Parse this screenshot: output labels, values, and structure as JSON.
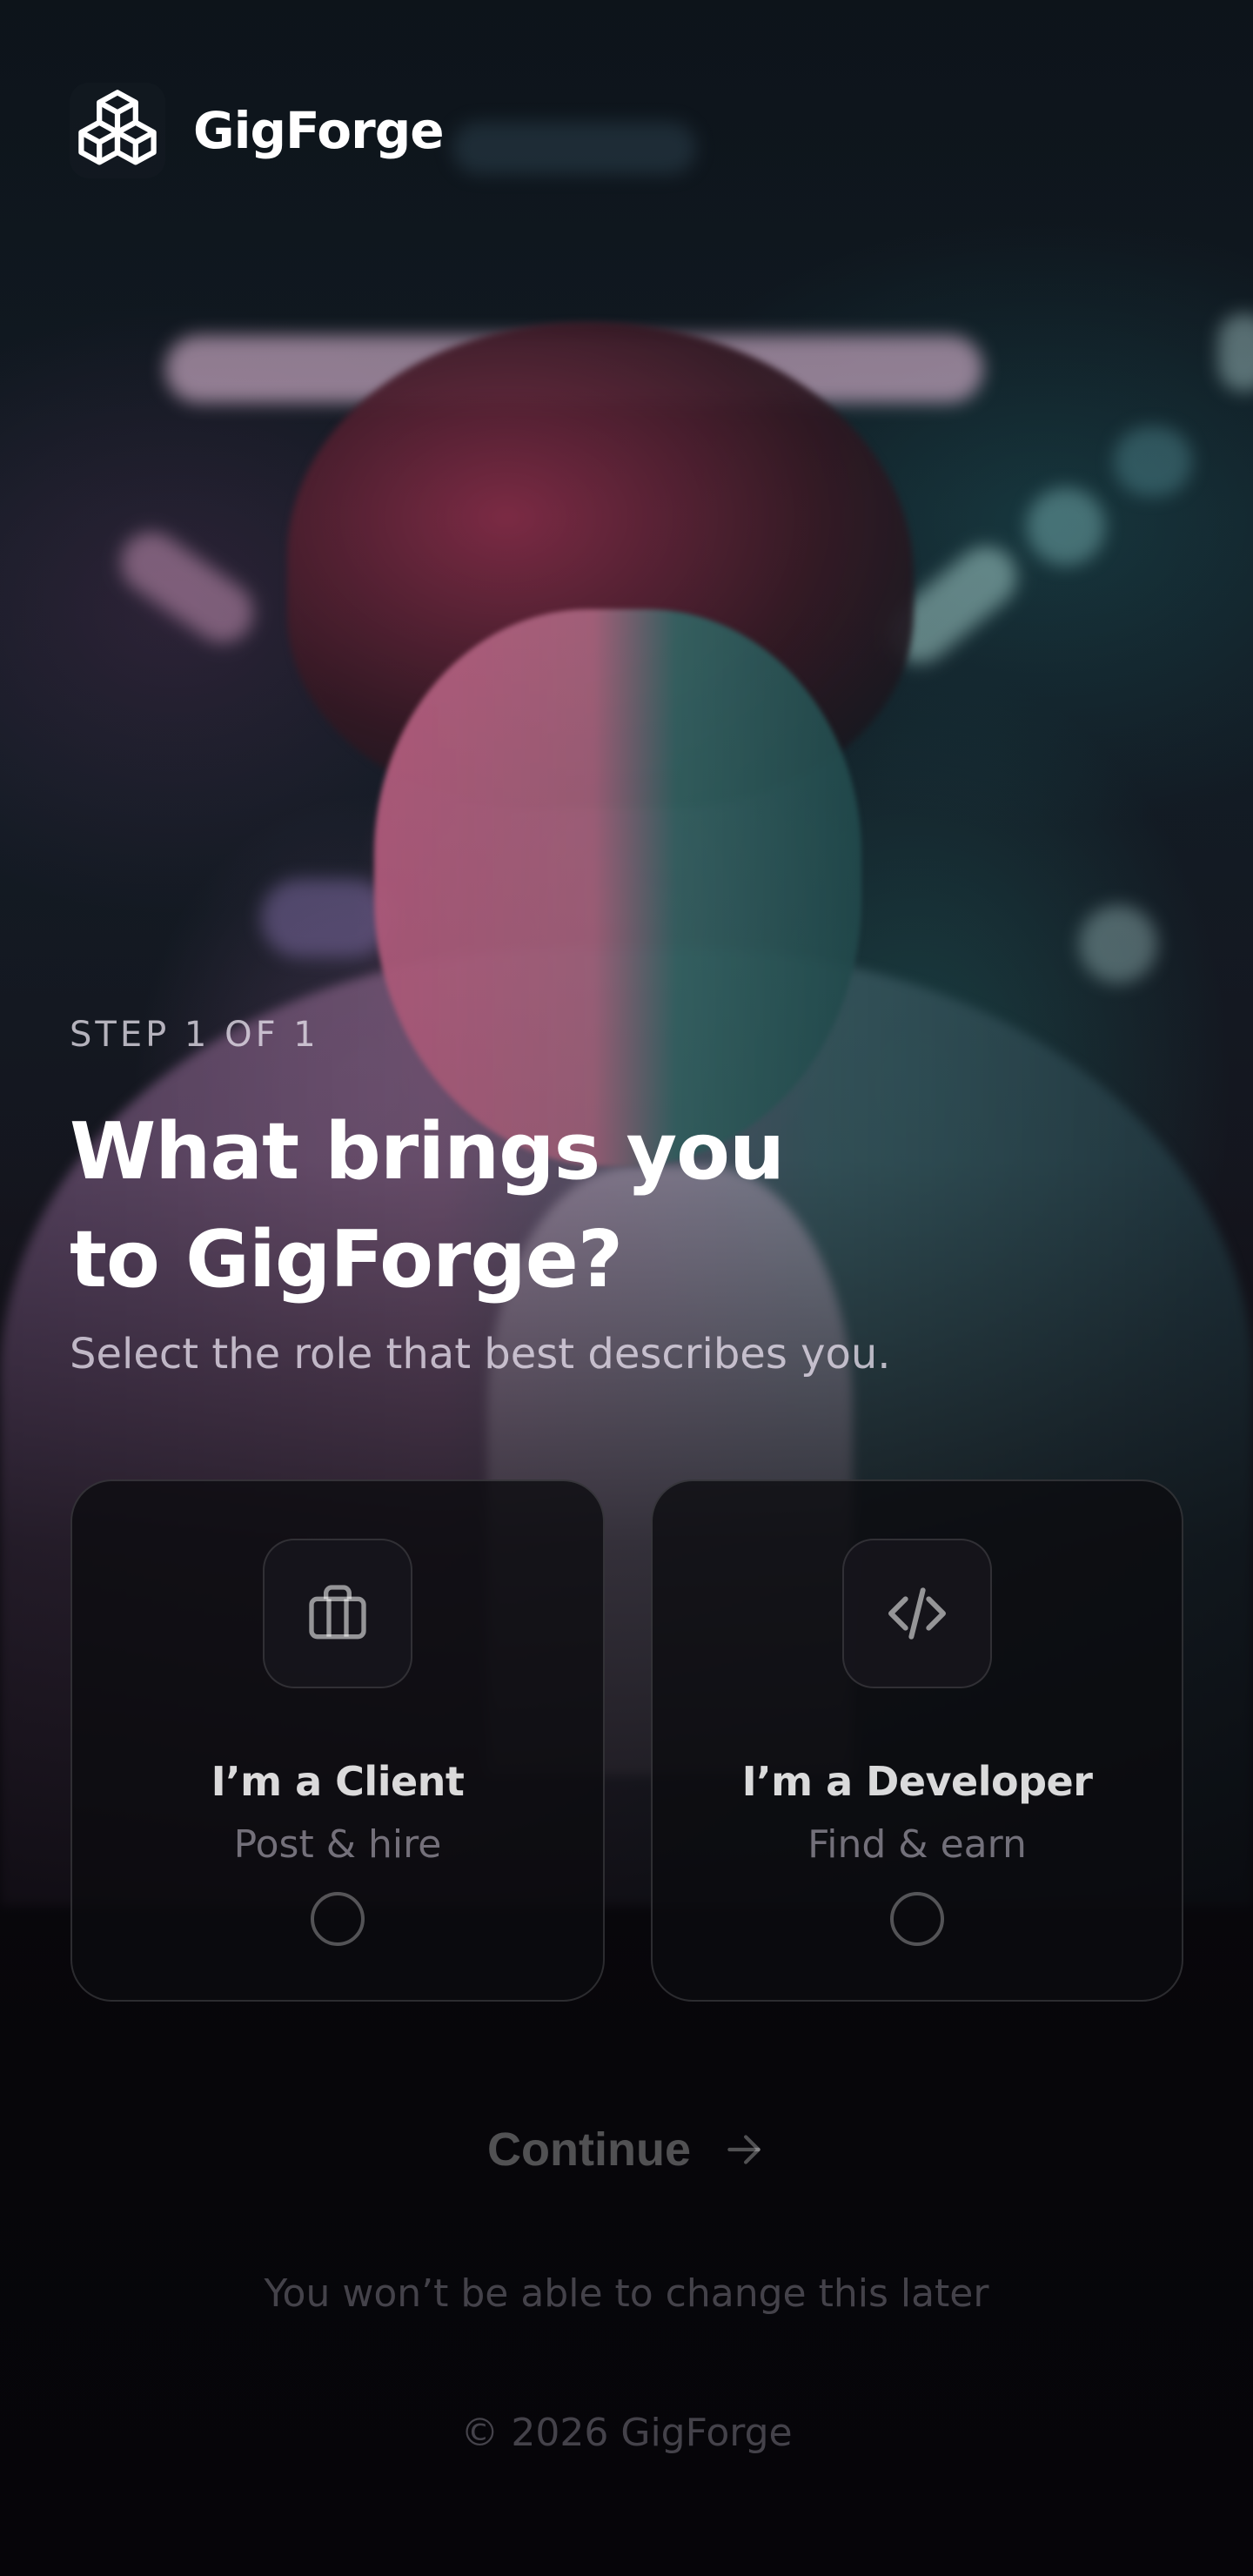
{
  "brand": {
    "name": "GigForge",
    "logo_icon": "cubes-logo-icon"
  },
  "background": {
    "description_icon": "portrait-photo",
    "accent_pink": "#d86e96",
    "accent_teal": "#2b7876"
  },
  "onboarding": {
    "step_label": "STEP 1 OF 1",
    "title_line1": "What brings you",
    "title_line2": "to GigForge?",
    "subtitle": "Select the role that best describes you."
  },
  "roles": [
    {
      "icon": "briefcase-icon",
      "title": "I’m a Client",
      "subtitle": "Post & hire",
      "selected": false
    },
    {
      "icon": "code-icon",
      "title": "I’m a Developer",
      "subtitle": "Find & earn",
      "selected": false
    }
  ],
  "actions": {
    "continue_label": "Continue",
    "continue_icon": "arrow-right-icon",
    "continue_enabled": false
  },
  "note": "You won’t be able to change this later",
  "footer": {
    "copyright": "© 2026 GigForge"
  }
}
